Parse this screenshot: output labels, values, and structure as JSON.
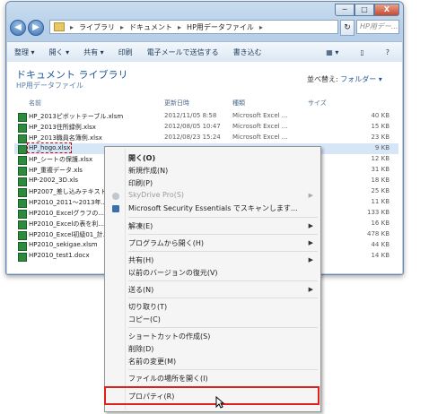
{
  "window": {
    "min_label": "─",
    "max_label": "□",
    "close_label": "X"
  },
  "address": {
    "crumbs": [
      "ライブラリ",
      "ドキュメント",
      "HP用データファイル"
    ],
    "search_placeholder": "HP用デー..."
  },
  "toolbar": {
    "organize": "整理 ▾",
    "open": "開く ▾",
    "share": "共有 ▾",
    "print": "印刷",
    "email": "電子メールで送信する",
    "burn": "書き込む",
    "view_icon": "▦ ▾",
    "pane_icon": "▯",
    "help_icon": "?"
  },
  "library": {
    "title": "ドキュメント ライブラリ",
    "subtitle": "HP用データファイル",
    "arrange_label": "並べ替え:",
    "arrange_value": "フォルダー ▾"
  },
  "columns": {
    "name": "名前",
    "date": "更新日時",
    "type": "種類",
    "size": "サイズ"
  },
  "files": [
    {
      "name": "HP_2013ピボットテーブル.xlsm",
      "date": "2012/11/05 8:58",
      "type": "Microsoft Excel ...",
      "size": "40 KB"
    },
    {
      "name": "HP_2013住所録例.xlsx",
      "date": "2012/08/05 10:47",
      "type": "Microsoft Excel ...",
      "size": "15 KB"
    },
    {
      "name": "HP_2013職員名簿例.xlsx",
      "date": "2012/08/23 15:24",
      "type": "Microsoft Excel ...",
      "size": "23 KB"
    },
    {
      "name": "HP_hogo.xlsx",
      "date": "",
      "type": "",
      "size": "9 KB"
    },
    {
      "name": "HP_シートの保護.xlsx",
      "date": "",
      "type": "",
      "size": "12 KB"
    },
    {
      "name": "HP_重複データ.xls",
      "date": "",
      "type": "",
      "size": "31 KB"
    },
    {
      "name": "HP-2002_3D.xls",
      "date": "",
      "type": "",
      "size": "18 KB"
    },
    {
      "name": "HP2007_差し込みテキスト...",
      "date": "",
      "type": "",
      "size": "25 KB"
    },
    {
      "name": "HP2010_2011～2013年...",
      "date": "",
      "type": "",
      "size": "11 KB"
    },
    {
      "name": "HP2010_Excelグラフの...",
      "date": "",
      "type": "",
      "size": "133 KB"
    },
    {
      "name": "HP2010_Excelの表を利...",
      "date": "",
      "type": "",
      "size": "16 KB"
    },
    {
      "name": "HP2010_Excel初級01_計...",
      "date": "",
      "type": "",
      "size": "478 KB"
    },
    {
      "name": "HP2010_sekigae.xlsm",
      "date": "",
      "type": "",
      "size": "44 KB"
    },
    {
      "name": "HP2010_test1.docx",
      "date": "",
      "type": "",
      "size": "14 KB"
    }
  ],
  "menu": {
    "open": "開く(O)",
    "new": "新規作成(N)",
    "print": "印刷(P)",
    "skydrive": "SkyDrive Pro(S)",
    "mse": "Microsoft Security Essentials でスキャンします...",
    "unzip": "解凍(E)",
    "open_with": "プログラムから開く(H)",
    "share": "共有(H)",
    "restore": "以前のバージョンの復元(V)",
    "send_to": "送る(N)",
    "cut": "切り取り(T)",
    "copy": "コピー(C)",
    "shortcut": "ショートカットの作成(S)",
    "delete": "削除(D)",
    "rename": "名前の変更(M)",
    "open_location": "ファイルの場所を開く(I)",
    "properties": "プロパティ(R)",
    "submenu_arrow": "▶"
  }
}
